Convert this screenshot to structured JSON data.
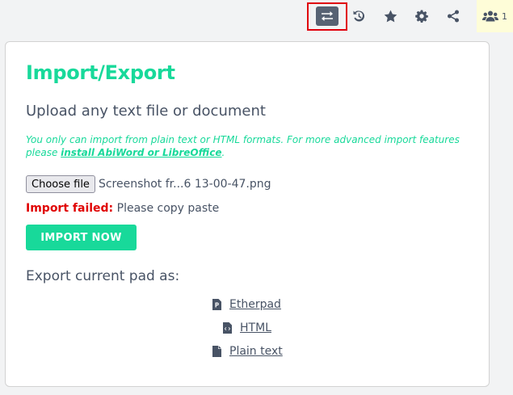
{
  "toolbar": {
    "items": [
      {
        "name": "import-export",
        "icon": "swap-arrows-icon",
        "active": true
      },
      {
        "name": "history",
        "icon": "history-icon"
      },
      {
        "name": "star",
        "icon": "star-icon"
      },
      {
        "name": "settings",
        "icon": "gear-icon"
      },
      {
        "name": "share",
        "icon": "share-icon"
      }
    ],
    "users": {
      "icon": "users-icon",
      "count": "1"
    }
  },
  "panel": {
    "title": "Import/Export",
    "upload_heading": "Upload any text file or document",
    "note_text": "You only can import from plain text or HTML formats. For more advanced import features please ",
    "note_link": "install AbiWord or LibreOffice",
    "note_end": ".",
    "file_button": "Choose file",
    "file_name": "Screenshot fr...6 13-00-47.png",
    "status_label": "Import failed:",
    "status_message": "Please copy paste",
    "import_button": "IMPORT NOW",
    "export_heading": "Export current pad as:",
    "export_options": [
      {
        "label": "Etherpad",
        "icon": "etherpad-file-icon"
      },
      {
        "label": "HTML",
        "icon": "code-file-icon"
      },
      {
        "label": "Plain text",
        "icon": "text-file-icon"
      }
    ]
  },
  "colors": {
    "accent": "#18d99a",
    "error": "#e00000",
    "text": "#485365",
    "highlight_outline": "#e0000c",
    "users_bg": "#fefdd8"
  }
}
